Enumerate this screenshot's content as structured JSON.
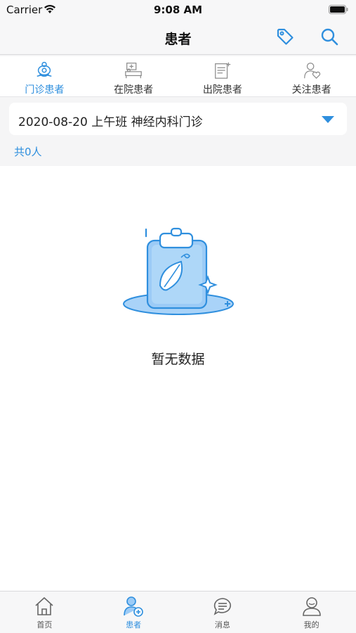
{
  "status_bar": {
    "carrier": "Carrier",
    "time": "9:08 AM"
  },
  "nav": {
    "title": "患者"
  },
  "tabs": [
    {
      "label": "门诊患者",
      "icon": "outpatient-icon",
      "active": true
    },
    {
      "label": "在院患者",
      "icon": "inpatient-bed-icon",
      "active": false
    },
    {
      "label": "出院患者",
      "icon": "discharge-document-icon",
      "active": false
    },
    {
      "label": "关注患者",
      "icon": "followed-patient-heart-icon",
      "active": false
    }
  ],
  "filter": {
    "value": "2020-08-20 上午班 神经内科门诊"
  },
  "count": {
    "text": "共0人"
  },
  "empty_state": {
    "text": "暂无数据",
    "icon": "empty-clipboard-illustration"
  },
  "bottom_tabs": [
    {
      "label": "首页",
      "icon": "home-icon",
      "active": false
    },
    {
      "label": "患者",
      "icon": "patient-icon",
      "active": true
    },
    {
      "label": "消息",
      "icon": "message-icon",
      "active": false
    },
    {
      "label": "我的",
      "icon": "profile-icon",
      "active": false
    }
  ],
  "colors": {
    "accent": "#2f8fde",
    "illustration_fill": "#9ccbf6",
    "background": "#f5f5f6"
  }
}
